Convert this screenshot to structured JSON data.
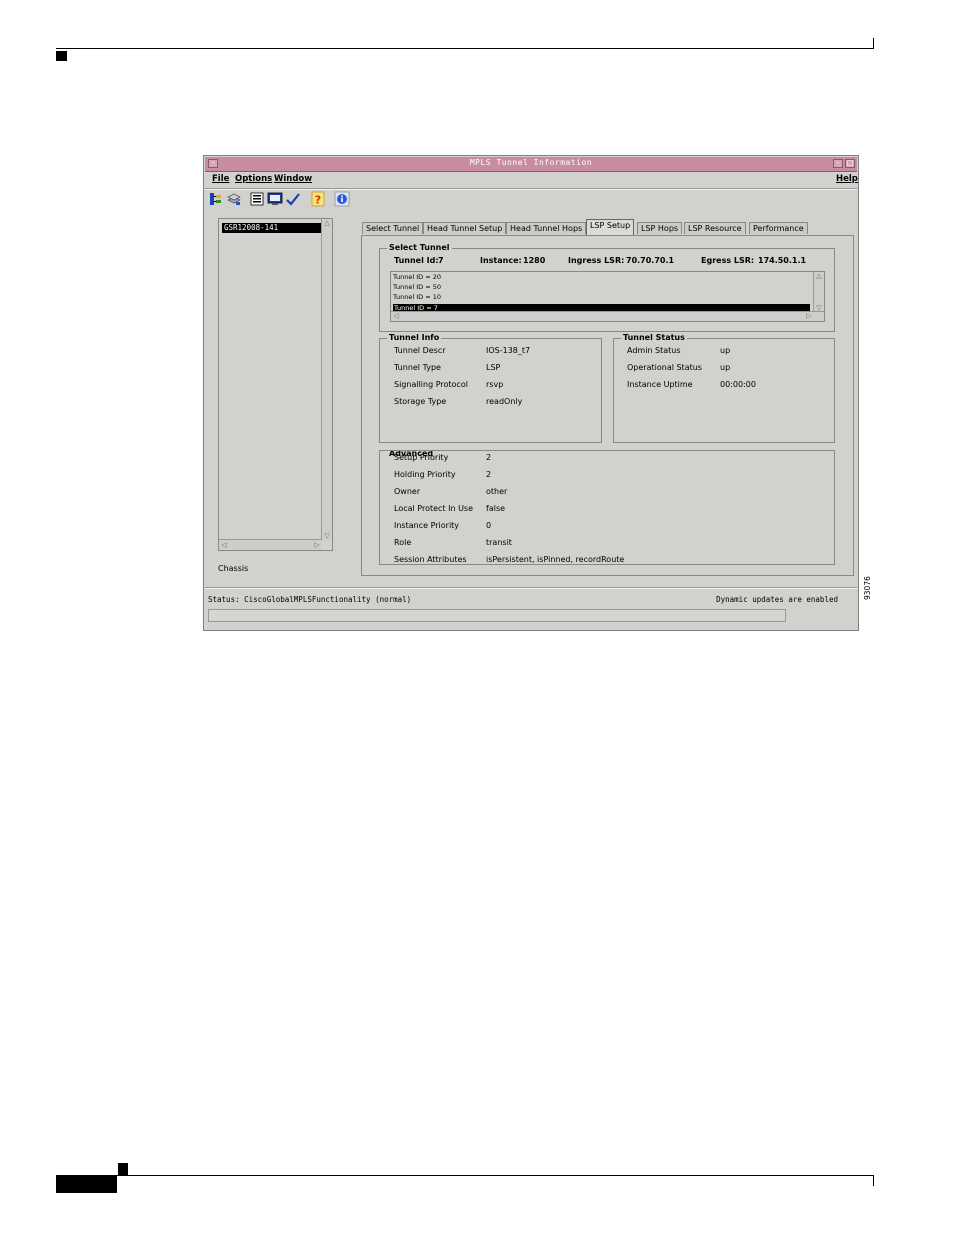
{
  "window": {
    "title": "MPLS Tunnel Information",
    "minimize_glyph": "-",
    "maximize_glyph": "□",
    "menu": {
      "file": "File",
      "options": "Options",
      "window": "Window",
      "help": "Help"
    },
    "toolbar_icons": [
      "tree-icon",
      "layers-icon",
      "list-icon",
      "monitor-icon",
      "checkmark-icon",
      "question-icon",
      "info-icon"
    ]
  },
  "tree": {
    "selected_node": "GSR12008-141",
    "footer_label": "Chassis"
  },
  "tabs": [
    {
      "label": "Select Tunnel"
    },
    {
      "label": "Head Tunnel Setup"
    },
    {
      "label": "Head Tunnel Hops"
    },
    {
      "label": "LSP Setup"
    },
    {
      "label": "LSP Hops"
    },
    {
      "label": "LSP Resource"
    },
    {
      "label": "Performance"
    }
  ],
  "active_tab": "LSP Setup",
  "select_tunnel": {
    "group_label": "Select Tunnel",
    "tunnel_id_label": "Tunnel Id:",
    "tunnel_id_value": "7",
    "instance_label": "Instance:",
    "instance_value": "1280",
    "ingress_label": "Ingress LSR:",
    "ingress_value": "70.70.70.1",
    "egress_label": "Egress LSR:",
    "egress_value": "174.50.1.1",
    "list": [
      "Tunnel ID = 20",
      "Tunnel ID = 50",
      "Tunnel ID = 10",
      "Tunnel ID = 7"
    ]
  },
  "tunnel_info": {
    "group_label": "Tunnel Info",
    "rows": [
      {
        "label": "Tunnel Descr",
        "value": "IOS-138_t7"
      },
      {
        "label": "Tunnel Type",
        "value": "LSP"
      },
      {
        "label": "Signalling Protocol",
        "value": "rsvp"
      },
      {
        "label": "Storage Type",
        "value": "readOnly"
      }
    ]
  },
  "tunnel_status": {
    "group_label": "Tunnel Status",
    "rows": [
      {
        "label": "Admin Status",
        "value": "up"
      },
      {
        "label": "Operational Status",
        "value": "up"
      },
      {
        "label": "Instance Uptime",
        "value": "00:00:00"
      }
    ]
  },
  "advanced": {
    "group_label": "Advanced",
    "rows": [
      {
        "label": "Setup Priority",
        "value": "2"
      },
      {
        "label": "Holding Priority",
        "value": "2"
      },
      {
        "label": "Owner",
        "value": "other"
      },
      {
        "label": "Local Protect In Use",
        "value": "false"
      },
      {
        "label": "Instance Priority",
        "value": "0"
      },
      {
        "label": "Role",
        "value": "transit"
      },
      {
        "label": "Session Attributes",
        "value": "isPersistent, isPinned, recordRoute"
      }
    ]
  },
  "status_bar": {
    "left": "Status: CiscoGlobalMPLSFunctionality (normal)",
    "right": "Dynamic updates are enabled"
  },
  "figure_number": "93076",
  "colors": {
    "titlebar": "#c98ba1",
    "window_bg": "#d3d1cd",
    "selection": "#000000"
  }
}
